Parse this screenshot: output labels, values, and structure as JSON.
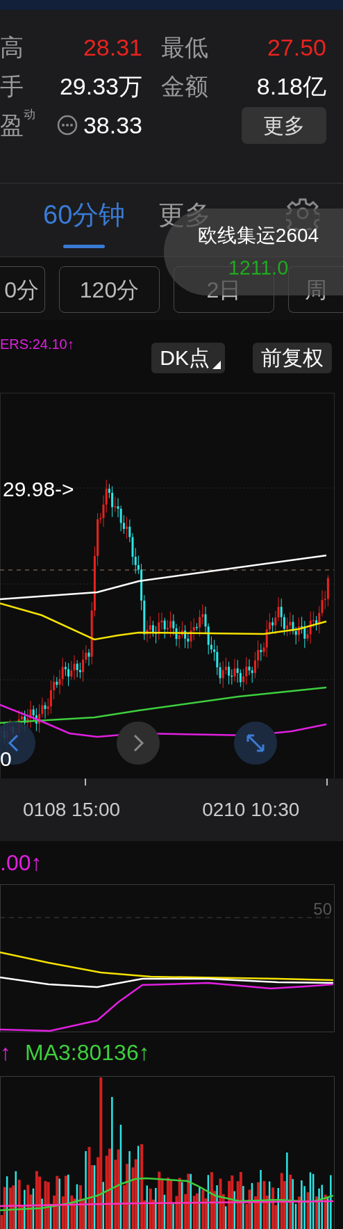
{
  "stats": [
    {
      "label": "高",
      "value": "28.31",
      "color": "#e8231f"
    },
    {
      "label": "最低",
      "value": "27.50",
      "color": "#e8231f"
    },
    {
      "label": "手",
      "value": "29.33万",
      "color": "#ffffff"
    },
    {
      "label": "金额",
      "value": "8.18亿",
      "color": "#ffffff"
    },
    {
      "label": "盈",
      "superscript": "动",
      "value": "38.33",
      "color": "#ffffff"
    }
  ],
  "more_button": "更多",
  "tabs": [
    {
      "label": "60分钟",
      "selected": true
    },
    {
      "label": "更多",
      "selected": false
    }
  ],
  "periods": [
    "0分",
    "120分",
    "2日",
    "周"
  ],
  "tooltip": {
    "title": "欧线集运2604",
    "value": "1211.0"
  },
  "indicator_label": "ERS:24.10↑",
  "buttons": [
    "DK点",
    "前复权"
  ],
  "chart": {
    "price_label": "29.98->",
    "axis_label": "0",
    "x_labels": [
      "0108 15:00",
      "0210 10:30"
    ]
  },
  "oscillator": {
    "label": ".00↑",
    "level_label": "50"
  },
  "volume": {
    "labels": [
      {
        "text": "↑",
        "color": "#e020e0"
      },
      {
        "text": "MA3:80136↑",
        "color": "#3ecf3e"
      }
    ]
  }
}
